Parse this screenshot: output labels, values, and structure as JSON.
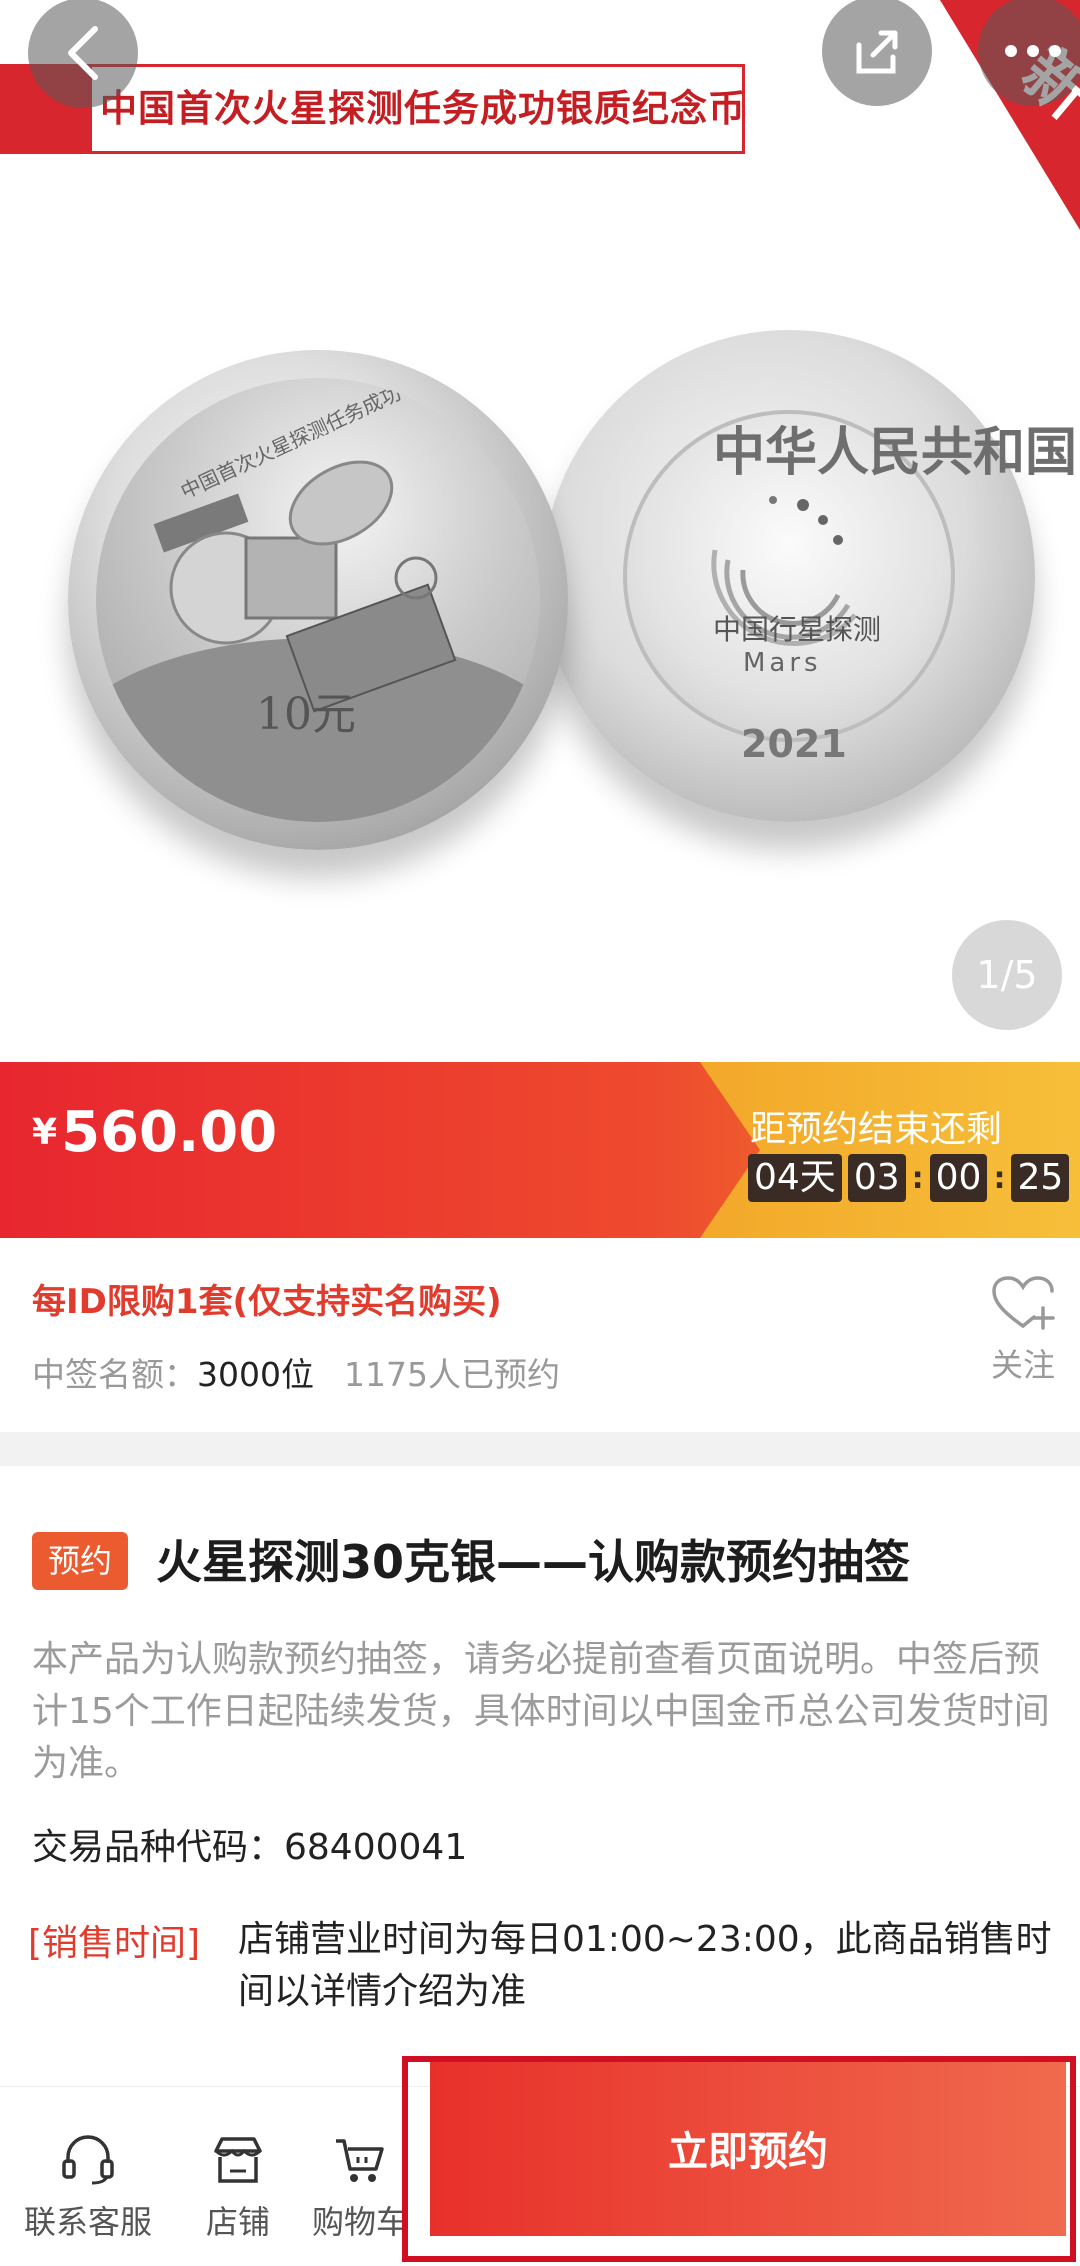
{
  "hero": {
    "banner_title": "中国首次火星探测任务成功银质纪念币",
    "corner_badge": "新",
    "image_counter": "1/5",
    "coin_obverse_inscription": "中国首次火星探测任务成功·天问一号",
    "coin_obverse_denomination": "10元",
    "coin_reverse_country": "中华人民共和国",
    "coin_reverse_logo": "中国行星探测",
    "coin_reverse_logo_en": "Mars",
    "coin_reverse_year": "2021"
  },
  "price_bar": {
    "currency": "¥",
    "price": "560.00",
    "countdown_title": "距预约结束还剩",
    "countdown": {
      "days": "04天",
      "hours": "03",
      "minutes": "00",
      "seconds": "25"
    }
  },
  "info": {
    "limit": "每ID限购1套(仅支持实名购买)",
    "quota_label": "中签名额：",
    "quota_value": "3000位",
    "reserved_count": "1175人已预约",
    "follow_label": "关注"
  },
  "product": {
    "tag": "预约",
    "title": "火星探测30克银——认购款预约抽签",
    "description": "本产品为认购款预约抽签，请务必提前查看页面说明。中签后预计15个工作日起陆续发货，具体时间以中国金币总公司发货时间为准。",
    "code_line": "交易品种代码：68400041",
    "sale_time_label": "[销售时间]",
    "sale_time_text": "店铺营业时间为每日01:00~23:00，此商品销售时间以详情介绍为准"
  },
  "bottom_nav": {
    "items": [
      {
        "label": "联系客服",
        "icon": "headset-icon"
      },
      {
        "label": "店铺",
        "icon": "store-icon"
      },
      {
        "label": "购物车",
        "icon": "cart-icon"
      }
    ],
    "reserve_label": "立即预约"
  },
  "colors": {
    "brand_red": "#e8262f",
    "accent_orange": "#f3a82a",
    "highlight_border": "#d10f22"
  }
}
